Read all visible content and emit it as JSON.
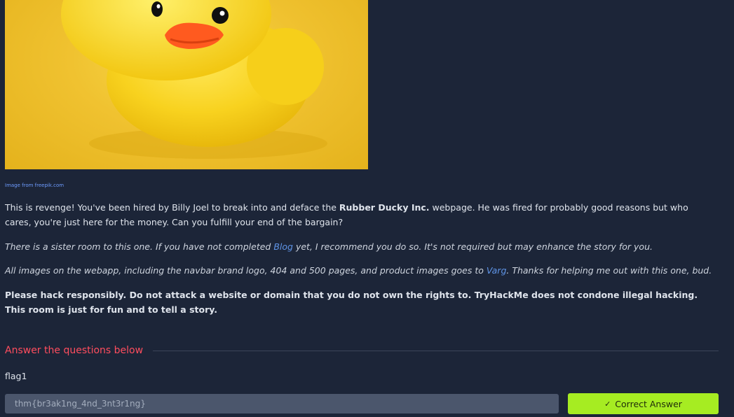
{
  "image_credit": "Image from freepik.com",
  "intro": {
    "part1": "This is revenge! You've been hired by Billy Joel to break into and deface the ",
    "company": "Rubber Ducky Inc.",
    "part2": " webpage. He was fired for probably good reasons but who cares, you're just here for the money. Can you fulfill your end of the bargain?"
  },
  "sister": {
    "part1": "There is a sister room to this one. If you have not completed ",
    "link": "Blog",
    "part2": " yet, I recommend you do so. It's not required but may enhance the story for you."
  },
  "images_note": {
    "part1": "All images on the webapp, including the navbar brand logo, 404 and 500 pages, and product images goes to ",
    "link": "Varg",
    "part2": ". Thanks for helping me out with this one, bud."
  },
  "disclaimer": "Please hack responsibly. Do not attack a website or domain that you do not own the rights to. TryHackMe does not condone illegal hacking. This room is just for fun and to tell a story.",
  "questions": {
    "header": "Answer the questions below",
    "items": [
      {
        "label": "flag1",
        "answer_value": "thm{br3ak1ng_4nd_3nt3r1ng}",
        "button_label": "Correct Answer",
        "button_icon": "check-icon",
        "button_color": "#a6ec22"
      }
    ]
  },
  "colors": {
    "background": "#1c2538",
    "accent_red": "#ff4d5e",
    "link_blue": "#5f95e8"
  }
}
